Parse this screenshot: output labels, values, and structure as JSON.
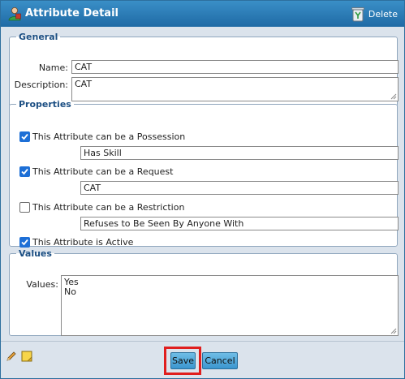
{
  "window": {
    "title": "Attribute Detail",
    "delete_label": "Delete"
  },
  "general": {
    "legend": "General",
    "name_label": "Name:",
    "name_value": "CAT",
    "description_label": "Description:",
    "description_value": "CAT"
  },
  "properties": {
    "legend": "Properties",
    "possession": {
      "label": "This Attribute can be a Possession",
      "checked": true,
      "value": "Has Skill"
    },
    "request": {
      "label": "This Attribute can be a Request",
      "checked": true,
      "value": "CAT"
    },
    "restriction": {
      "label": "This Attribute can be a Restriction",
      "checked": false,
      "value": "Refuses to Be Seen By Anyone With"
    },
    "active": {
      "label": "This Attribute is Active",
      "checked": true
    }
  },
  "values": {
    "legend": "Values",
    "label": "Values:",
    "items": "Yes\nNo"
  },
  "footer": {
    "save_label": "Save",
    "cancel_label": "Cancel"
  },
  "colors": {
    "titlebar": "#1f6aa5",
    "checkbox_checked": "#1d6fd6",
    "highlight": "#e01e1e"
  }
}
